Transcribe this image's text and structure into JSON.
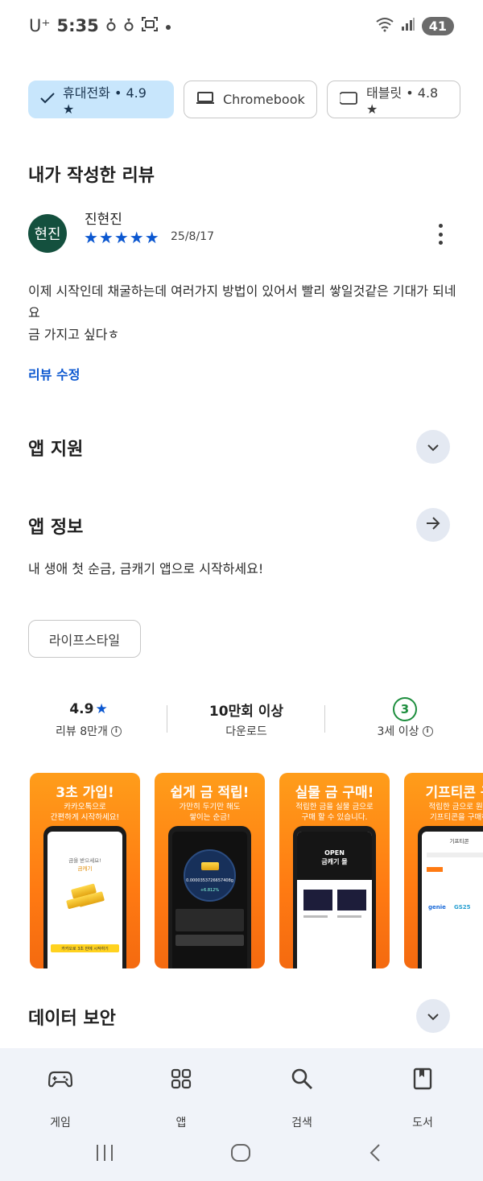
{
  "status_bar": {
    "carrier": "U⁺",
    "time": "5:35",
    "battery": "41"
  },
  "devices": [
    {
      "label": "휴대전화 • 4.9 ★",
      "selected": true
    },
    {
      "label": "Chromebook",
      "selected": false
    },
    {
      "label": "태블릿 • 4.8 ★",
      "selected": false
    }
  ],
  "my_review": {
    "section_title": "내가 작성한 리뷰",
    "avatar_text": "현진",
    "avatar_color": "#14503e",
    "author": "진현진",
    "stars": "★★★★★",
    "rating": 5,
    "date": "25/8/17",
    "text": "이제 시작인데 채굴하는데 여러가지 방법이 있어서 빨리 쌓일것같은 기대가 되네요\n금 가지고 싶다ㅎ",
    "edit_label": "리뷰 수정"
  },
  "app_support": {
    "title": "앱 지원"
  },
  "app_info": {
    "title": "앱 정보",
    "description": "내 생애 첫 순금, 금캐기 앱으로 시작하세요!",
    "category": "라이프스타일"
  },
  "stats": {
    "rating": "4.9",
    "rating_label": "리뷰 8만개",
    "downloads": "10만회 이상",
    "downloads_label": "다운로드",
    "age_badge": "3",
    "age_label": "3세 이상"
  },
  "screenshots": [
    {
      "title": "3초 가입!",
      "subtitle": "카카오톡으로\n간편하게 시작하세요!",
      "screen_text_1": "금을 받으세요!",
      "screen_text_2": "금캐기",
      "screen_footer": "카카오로 3초 만에 시작하기"
    },
    {
      "title": "쉽게 금 적립!",
      "subtitle": "가만히 두기만 해도\n쌓이는 순금!",
      "screen_value": "0.0000353726657408g",
      "screen_rate": "+6.812%"
    },
    {
      "title": "실물 금 구매!",
      "subtitle": "적립한 금을 실물 금으로\n구매 할 수 있습니다.",
      "screen_banner_1": "OPEN",
      "screen_banner_2": "금캐기 몰"
    },
    {
      "title": "기프티콘 구",
      "subtitle": "적립한 금으로 원하\n기프티콘을 구매하",
      "screen_header": "기프티콘",
      "brands": [
        "genie",
        "GS25"
      ]
    }
  ],
  "data_safety": {
    "title": "데이터 보안"
  },
  "bottom_nav": [
    {
      "label": "게임",
      "icon": "gamepad-icon"
    },
    {
      "label": "앱",
      "icon": "apps-grid-icon"
    },
    {
      "label": "검색",
      "icon": "search-icon"
    },
    {
      "label": "도서",
      "icon": "book-icon"
    }
  ],
  "colors": {
    "accent": "#0b57d0",
    "chip_selected_bg": "#c8e6fc",
    "age_green": "#1e8e3e",
    "screenshot_orange": "#ff8a15"
  }
}
